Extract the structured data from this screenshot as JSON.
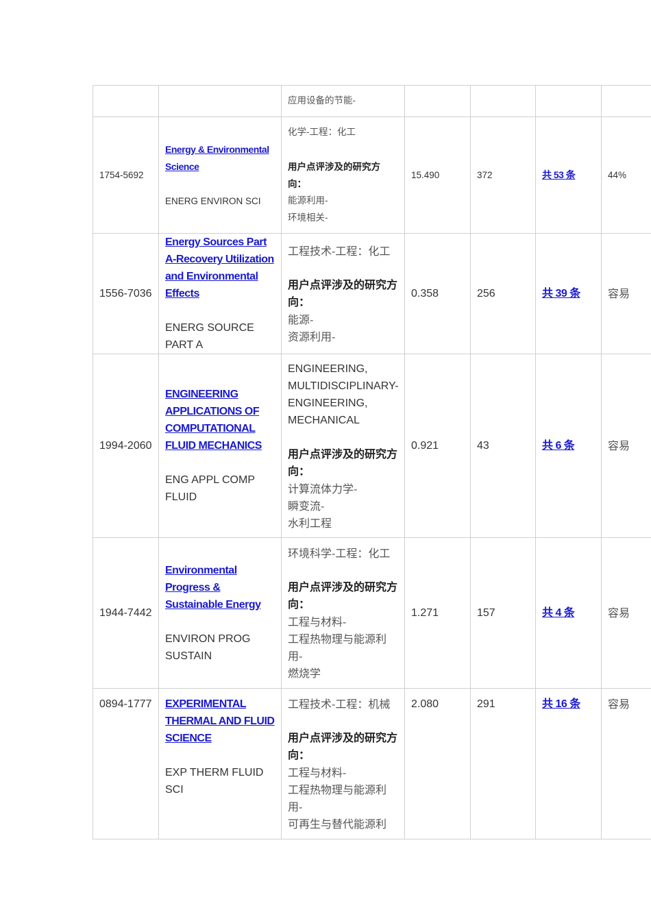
{
  "rows": [
    {
      "issn": "",
      "title": "",
      "abbr": "",
      "field": "",
      "user_label": "",
      "topics": [
        "应用设备的节能-"
      ],
      "impact": "",
      "count": "",
      "reviews": "",
      "rate": ""
    },
    {
      "issn": "1754-5692",
      "title": "Energy & Environmental Science",
      "abbr": "ENERG ENVIRON SCI",
      "field": "化学-工程：化工",
      "user_label": "用户点评涉及的研究方向：",
      "topics": [
        "能源利用-",
        "环境相关-"
      ],
      "impact": "15.490",
      "count": "372",
      "reviews": "共 53 条",
      "rate": "44%"
    },
    {
      "issn": "1556-7036",
      "title": "Energy Sources Part A-Recovery Utilization and Environmental Effects",
      "abbr": "ENERG SOURCE PART A",
      "field": "工程技术-工程：化工",
      "user_label": "用户点评涉及的研究方向：",
      "topics": [
        "能源-",
        "资源利用-"
      ],
      "impact": "0.358",
      "count": "256",
      "reviews": "共 39 条",
      "rate": "容易"
    },
    {
      "issn": "1994-2060",
      "title": "ENGINEERING APPLICATIONS OF COMPUTATIONAL FLUID MECHANICS",
      "abbr": "ENG APPL COMP FLUID",
      "field": "ENGINEERING, MULTIDISCIPLINARY-ENGINEERING, MECHANICAL",
      "user_label": "用户点评涉及的研究方向：",
      "topics": [
        "计算流体力学-",
        "瞬变流-",
        "水利工程"
      ],
      "impact": "0.921",
      "count": "43",
      "reviews": "共 6 条",
      "rate": "容易"
    },
    {
      "issn": "1944-7442",
      "title": "Environmental Progress & Sustainable Energy",
      "abbr": "ENVIRON PROG SUSTAIN",
      "field": "环境科学-工程：化工",
      "user_label": "用户点评涉及的研究方向：",
      "topics": [
        "工程与材料-",
        "工程热物理与能源利用-",
        "燃烧学"
      ],
      "impact": "1.271",
      "count": "157",
      "reviews": "共 4 条",
      "rate": "容易"
    },
    {
      "issn": "0894-1777",
      "title": "EXPERIMENTAL THERMAL AND FLUID SCIENCE",
      "abbr": "EXP THERM FLUID SCI",
      "field": "工程技术-工程：机械",
      "user_label": "用户点评涉及的研究方向：",
      "topics": [
        "工程与材料-",
        "工程热物理与能源利用-",
        "可再生与替代能源利"
      ],
      "impact": "2.080",
      "count": "291",
      "reviews": "共 16 条",
      "rate": "容易"
    }
  ]
}
